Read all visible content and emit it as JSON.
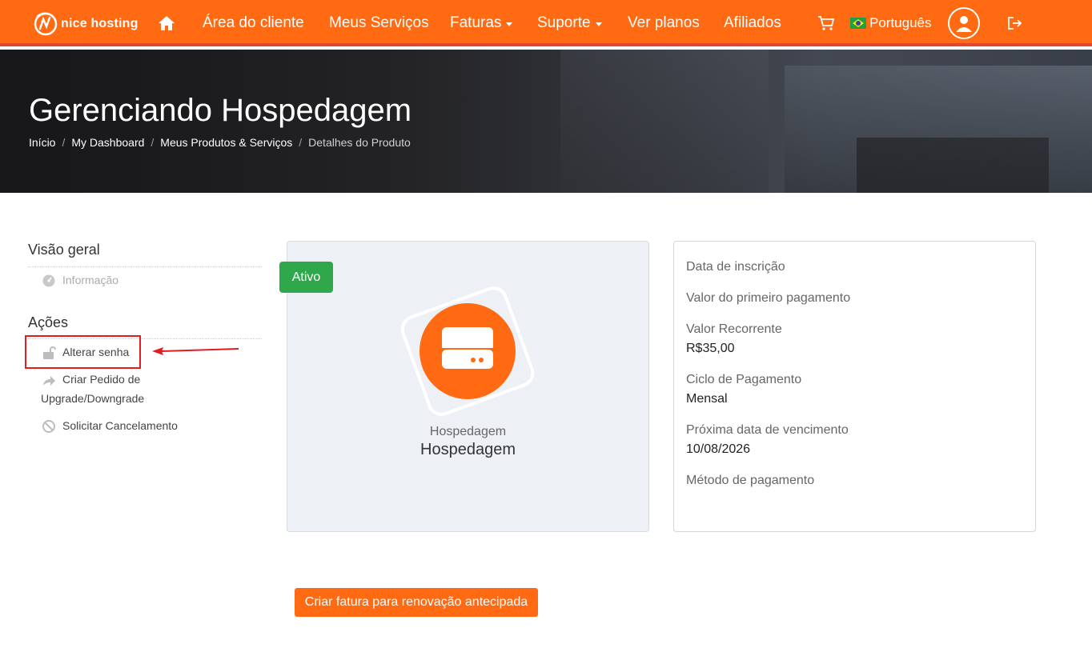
{
  "navbar": {
    "brand": "nice hosting",
    "items": [
      {
        "label": "Área do cliente"
      },
      {
        "label": "Meus Serviços"
      },
      {
        "label": "Faturas"
      },
      {
        "label": "Suporte"
      },
      {
        "label": "Ver planos"
      },
      {
        "label": "Afiliados"
      }
    ],
    "language": "Português",
    "icons": [
      "home-icon",
      "cart-icon",
      "brazil-flag-icon",
      "user-icon",
      "logout-icon"
    ],
    "accent_color": "#ff6a13"
  },
  "hero": {
    "title": "Gerenciando Hospedagem",
    "breadcrumb": [
      "Início",
      "My Dashboard",
      "Meus Produtos & Serviços",
      "Detalhes do Produto"
    ]
  },
  "sidebar": {
    "overview_heading": "Visão geral",
    "overview_items": [
      {
        "label": "Informação",
        "icon": "dashboard-icon"
      }
    ],
    "actions_heading": "Ações",
    "action_items": [
      {
        "label": "Alterar senha",
        "icon": "unlock-icon"
      },
      {
        "label_line1": "Criar Pedido de",
        "label_line2": "Upgrade/Downgrade",
        "icon": "share-arrow-icon"
      },
      {
        "label": "Solicitar Cancelamento",
        "icon": "ban-icon"
      }
    ]
  },
  "product": {
    "status": "Ativo",
    "status_color": "#2ea84a",
    "category": "Hospedagem",
    "name": "Hospedagem",
    "icon": "server-icon"
  },
  "details": {
    "signup_date_label": "Data de inscrição",
    "first_payment_label": "Valor do primeiro pagamento",
    "recurring_label": "Valor Recorrente",
    "recurring_value": "R$35,00",
    "cycle_label": "Ciclo de Pagamento",
    "cycle_value": "Mensal",
    "next_due_label": "Próxima data de vencimento",
    "next_due_value": "10/08/2026",
    "payment_method_label": "Método de pagamento"
  },
  "renew_button": "Criar fatura para renovação antecipada"
}
